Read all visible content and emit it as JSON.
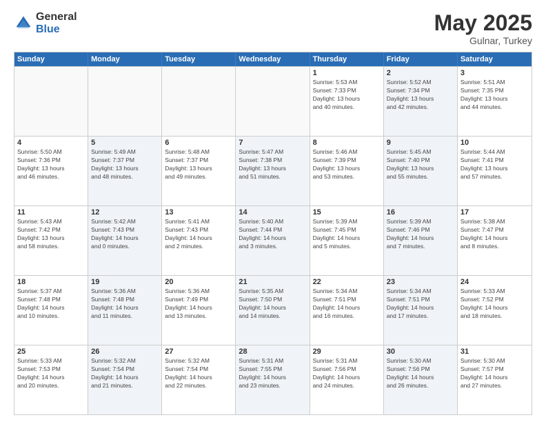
{
  "logo": {
    "general": "General",
    "blue": "Blue"
  },
  "title": {
    "month": "May 2025",
    "location": "Gulnar, Turkey"
  },
  "headers": [
    "Sunday",
    "Monday",
    "Tuesday",
    "Wednesday",
    "Thursday",
    "Friday",
    "Saturday"
  ],
  "weeks": [
    [
      {
        "day": "",
        "info": "",
        "shaded": false,
        "empty": true
      },
      {
        "day": "",
        "info": "",
        "shaded": false,
        "empty": true
      },
      {
        "day": "",
        "info": "",
        "shaded": false,
        "empty": true
      },
      {
        "day": "",
        "info": "",
        "shaded": false,
        "empty": true
      },
      {
        "day": "1",
        "info": "Sunrise: 5:53 AM\nSunset: 7:33 PM\nDaylight: 13 hours\nand 40 minutes.",
        "shaded": false,
        "empty": false
      },
      {
        "day": "2",
        "info": "Sunrise: 5:52 AM\nSunset: 7:34 PM\nDaylight: 13 hours\nand 42 minutes.",
        "shaded": true,
        "empty": false
      },
      {
        "day": "3",
        "info": "Sunrise: 5:51 AM\nSunset: 7:35 PM\nDaylight: 13 hours\nand 44 minutes.",
        "shaded": false,
        "empty": false
      }
    ],
    [
      {
        "day": "4",
        "info": "Sunrise: 5:50 AM\nSunset: 7:36 PM\nDaylight: 13 hours\nand 46 minutes.",
        "shaded": false,
        "empty": false
      },
      {
        "day": "5",
        "info": "Sunrise: 5:49 AM\nSunset: 7:37 PM\nDaylight: 13 hours\nand 48 minutes.",
        "shaded": true,
        "empty": false
      },
      {
        "day": "6",
        "info": "Sunrise: 5:48 AM\nSunset: 7:37 PM\nDaylight: 13 hours\nand 49 minutes.",
        "shaded": false,
        "empty": false
      },
      {
        "day": "7",
        "info": "Sunrise: 5:47 AM\nSunset: 7:38 PM\nDaylight: 13 hours\nand 51 minutes.",
        "shaded": true,
        "empty": false
      },
      {
        "day": "8",
        "info": "Sunrise: 5:46 AM\nSunset: 7:39 PM\nDaylight: 13 hours\nand 53 minutes.",
        "shaded": false,
        "empty": false
      },
      {
        "day": "9",
        "info": "Sunrise: 5:45 AM\nSunset: 7:40 PM\nDaylight: 13 hours\nand 55 minutes.",
        "shaded": true,
        "empty": false
      },
      {
        "day": "10",
        "info": "Sunrise: 5:44 AM\nSunset: 7:41 PM\nDaylight: 13 hours\nand 57 minutes.",
        "shaded": false,
        "empty": false
      }
    ],
    [
      {
        "day": "11",
        "info": "Sunrise: 5:43 AM\nSunset: 7:42 PM\nDaylight: 13 hours\nand 58 minutes.",
        "shaded": false,
        "empty": false
      },
      {
        "day": "12",
        "info": "Sunrise: 5:42 AM\nSunset: 7:43 PM\nDaylight: 14 hours\nand 0 minutes.",
        "shaded": true,
        "empty": false
      },
      {
        "day": "13",
        "info": "Sunrise: 5:41 AM\nSunset: 7:43 PM\nDaylight: 14 hours\nand 2 minutes.",
        "shaded": false,
        "empty": false
      },
      {
        "day": "14",
        "info": "Sunrise: 5:40 AM\nSunset: 7:44 PM\nDaylight: 14 hours\nand 3 minutes.",
        "shaded": true,
        "empty": false
      },
      {
        "day": "15",
        "info": "Sunrise: 5:39 AM\nSunset: 7:45 PM\nDaylight: 14 hours\nand 5 minutes.",
        "shaded": false,
        "empty": false
      },
      {
        "day": "16",
        "info": "Sunrise: 5:39 AM\nSunset: 7:46 PM\nDaylight: 14 hours\nand 7 minutes.",
        "shaded": true,
        "empty": false
      },
      {
        "day": "17",
        "info": "Sunrise: 5:38 AM\nSunset: 7:47 PM\nDaylight: 14 hours\nand 8 minutes.",
        "shaded": false,
        "empty": false
      }
    ],
    [
      {
        "day": "18",
        "info": "Sunrise: 5:37 AM\nSunset: 7:48 PM\nDaylight: 14 hours\nand 10 minutes.",
        "shaded": false,
        "empty": false
      },
      {
        "day": "19",
        "info": "Sunrise: 5:36 AM\nSunset: 7:48 PM\nDaylight: 14 hours\nand 11 minutes.",
        "shaded": true,
        "empty": false
      },
      {
        "day": "20",
        "info": "Sunrise: 5:36 AM\nSunset: 7:49 PM\nDaylight: 14 hours\nand 13 minutes.",
        "shaded": false,
        "empty": false
      },
      {
        "day": "21",
        "info": "Sunrise: 5:35 AM\nSunset: 7:50 PM\nDaylight: 14 hours\nand 14 minutes.",
        "shaded": true,
        "empty": false
      },
      {
        "day": "22",
        "info": "Sunrise: 5:34 AM\nSunset: 7:51 PM\nDaylight: 14 hours\nand 16 minutes.",
        "shaded": false,
        "empty": false
      },
      {
        "day": "23",
        "info": "Sunrise: 5:34 AM\nSunset: 7:51 PM\nDaylight: 14 hours\nand 17 minutes.",
        "shaded": true,
        "empty": false
      },
      {
        "day": "24",
        "info": "Sunrise: 5:33 AM\nSunset: 7:52 PM\nDaylight: 14 hours\nand 18 minutes.",
        "shaded": false,
        "empty": false
      }
    ],
    [
      {
        "day": "25",
        "info": "Sunrise: 5:33 AM\nSunset: 7:53 PM\nDaylight: 14 hours\nand 20 minutes.",
        "shaded": false,
        "empty": false
      },
      {
        "day": "26",
        "info": "Sunrise: 5:32 AM\nSunset: 7:54 PM\nDaylight: 14 hours\nand 21 minutes.",
        "shaded": true,
        "empty": false
      },
      {
        "day": "27",
        "info": "Sunrise: 5:32 AM\nSunset: 7:54 PM\nDaylight: 14 hours\nand 22 minutes.",
        "shaded": false,
        "empty": false
      },
      {
        "day": "28",
        "info": "Sunrise: 5:31 AM\nSunset: 7:55 PM\nDaylight: 14 hours\nand 23 minutes.",
        "shaded": true,
        "empty": false
      },
      {
        "day": "29",
        "info": "Sunrise: 5:31 AM\nSunset: 7:56 PM\nDaylight: 14 hours\nand 24 minutes.",
        "shaded": false,
        "empty": false
      },
      {
        "day": "30",
        "info": "Sunrise: 5:30 AM\nSunset: 7:56 PM\nDaylight: 14 hours\nand 26 minutes.",
        "shaded": true,
        "empty": false
      },
      {
        "day": "31",
        "info": "Sunrise: 5:30 AM\nSunset: 7:57 PM\nDaylight: 14 hours\nand 27 minutes.",
        "shaded": false,
        "empty": false
      }
    ]
  ]
}
